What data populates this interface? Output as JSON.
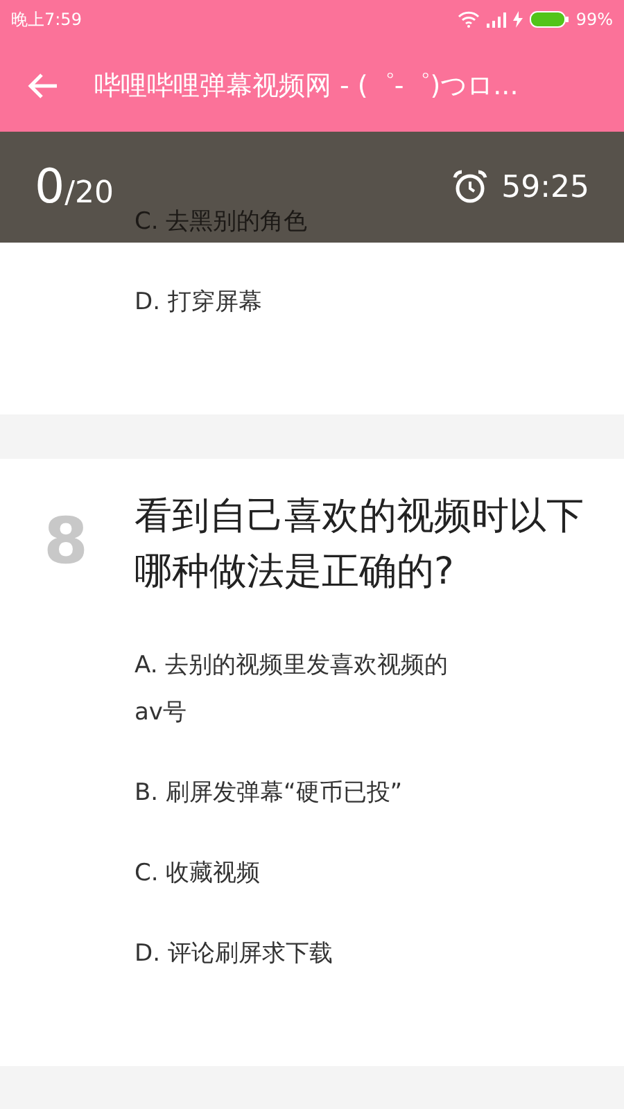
{
  "status_bar": {
    "time": "晚上7:59",
    "battery": "99%"
  },
  "toolbar": {
    "title": "哔哩哔哩弹幕视频网 - (゜-゜)つロ..."
  },
  "progress": {
    "answered": "0",
    "total": "/20",
    "timer": "59:25"
  },
  "questions": [
    {
      "options": [
        "C. 去黑别的角色",
        "D. 打穿屏幕"
      ]
    },
    {
      "number": "8",
      "text": "看到自己喜欢的视频时以下哪种做法是正确的?",
      "options": [
        "A. 去别的视频里发喜欢视频的av号",
        "B. 刷屏发弹幕“硬币已投”",
        "C. 收藏视频",
        "D. 评论刷屏求下载"
      ]
    }
  ]
}
